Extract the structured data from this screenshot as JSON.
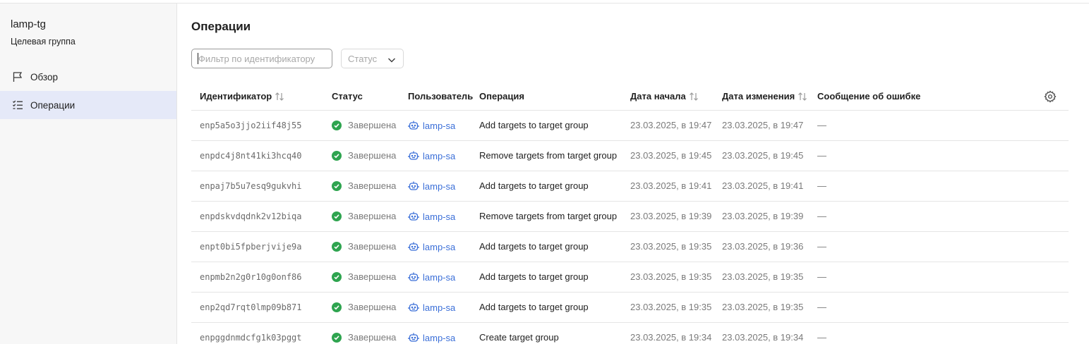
{
  "sidebar": {
    "title": "lamp-tg",
    "subtitle": "Целевая группа",
    "items": [
      {
        "label": "Обзор",
        "icon": "flag-icon",
        "active": false
      },
      {
        "label": "Операции",
        "icon": "checklist-icon",
        "active": true
      }
    ]
  },
  "main": {
    "title": "Операции",
    "filter": {
      "placeholder": "Фильтр по идентификатору",
      "value": ""
    },
    "status_select": {
      "label": "Статус"
    }
  },
  "table": {
    "columns": {
      "id": "Идентификатор",
      "status": "Статус",
      "user": "Пользователь",
      "operation": "Операция",
      "start": "Дата начала",
      "modified": "Дата изменения",
      "error": "Сообщение об ошибке"
    },
    "rows": [
      {
        "id": "enp5a5o3jjo2iif48j55",
        "status": "Завершена",
        "user": "lamp-sa",
        "operation": "Add targets to target group",
        "start": "23.03.2025, в 19:47",
        "modified": "23.03.2025, в 19:47",
        "error": "—"
      },
      {
        "id": "enpdc4j8nt41ki3hcq40",
        "status": "Завершена",
        "user": "lamp-sa",
        "operation": "Remove targets from target group",
        "start": "23.03.2025, в 19:45",
        "modified": "23.03.2025, в 19:45",
        "error": "—"
      },
      {
        "id": "enpaj7b5u7esq9gukvhi",
        "status": "Завершена",
        "user": "lamp-sa",
        "operation": "Add targets to target group",
        "start": "23.03.2025, в 19:41",
        "modified": "23.03.2025, в 19:41",
        "error": "—"
      },
      {
        "id": "enpdskvdqdnk2v12biqa",
        "status": "Завершена",
        "user": "lamp-sa",
        "operation": "Remove targets from target group",
        "start": "23.03.2025, в 19:39",
        "modified": "23.03.2025, в 19:39",
        "error": "—"
      },
      {
        "id": "enpt0bi5fpberjvije9a",
        "status": "Завершена",
        "user": "lamp-sa",
        "operation": "Add targets to target group",
        "start": "23.03.2025, в 19:35",
        "modified": "23.03.2025, в 19:36",
        "error": "—"
      },
      {
        "id": "enpmb2n2g0r10g0onf86",
        "status": "Завершена",
        "user": "lamp-sa",
        "operation": "Add targets to target group",
        "start": "23.03.2025, в 19:35",
        "modified": "23.03.2025, в 19:35",
        "error": "—"
      },
      {
        "id": "enp2qd7rqt0lmp09b871",
        "status": "Завершена",
        "user": "lamp-sa",
        "operation": "Add targets to target group",
        "start": "23.03.2025, в 19:35",
        "modified": "23.03.2025, в 19:35",
        "error": "—"
      },
      {
        "id": "enpggdnmdcfg1k03pggt",
        "status": "Завершена",
        "user": "lamp-sa",
        "operation": "Create target group",
        "start": "23.03.2025, в 19:34",
        "modified": "23.03.2025, в 19:34",
        "error": "—"
      }
    ]
  },
  "colors": {
    "active_nav_bg": "#e5e9f8",
    "success": "#2ea44f",
    "link": "#3b6fd8"
  }
}
